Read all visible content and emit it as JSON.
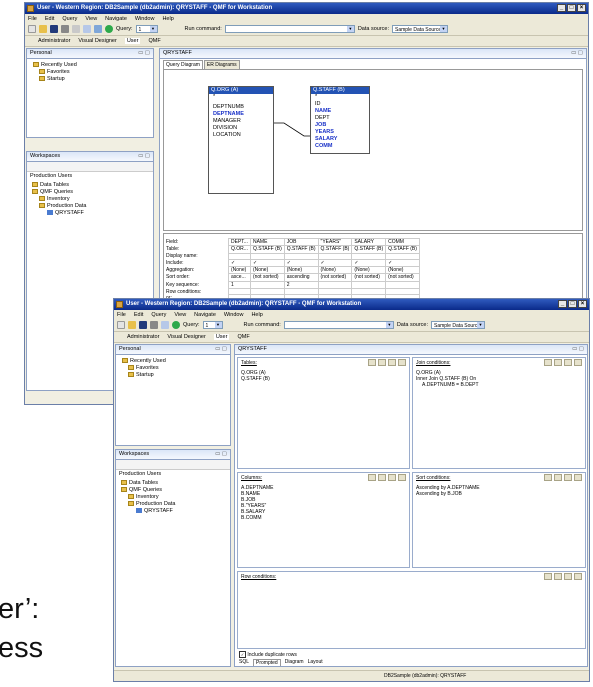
{
  "bg_text": {
    "line1": "er’:",
    "line2": "ess"
  },
  "back": {
    "title": "User - Western Region: DB2Sample (db2admin): QRYSTAFF - QMF for Workstation",
    "menu": [
      "File",
      "Edit",
      "Query",
      "View",
      "Navigate",
      "Window",
      "Help"
    ],
    "toolbar": {
      "query_label": "Query:",
      "query_value": "1",
      "run_label": "Run command:",
      "ds_label": "Data source:",
      "ds_value": "Sample Data Source"
    },
    "perspectives": [
      "Administrator",
      "Visual Designer",
      "User",
      "QMF"
    ],
    "personal": {
      "title": "Personal",
      "items": [
        "Recently Used",
        "Favorites",
        "Startup"
      ]
    },
    "workspaces": {
      "title": "Workspaces",
      "header": "Production Users",
      "items": [
        "Data Tables",
        "QMF Queries",
        "Inventory",
        "Production Data",
        "QRYSTAFF"
      ]
    },
    "editor_tab": "QRYSTAFF",
    "subtabs": [
      "Query Diagram",
      "ER Diagrams"
    ],
    "table_org": {
      "title": "Q.ORG (A)",
      "cols": [
        "*",
        "DEPTNUMB",
        "DEPTNAME",
        "MANAGER",
        "DIVISION",
        "LOCATION"
      ]
    },
    "table_staff": {
      "title": "Q.STAFF (B)",
      "cols": [
        "*",
        "ID",
        "NAME",
        "DEPT",
        "JOB",
        "YEARS",
        "SALARY",
        "COMM"
      ]
    },
    "grid": {
      "row_labels": [
        "Field:",
        "Table:",
        "Display name:",
        "Include:",
        "Aggregation:",
        "Sort order:",
        "Key sequence:",
        "Row conditions:",
        "or:"
      ],
      "columns": [
        [
          "DEPT...",
          "Q.OR...",
          "",
          "✓",
          "(None)",
          "asce...",
          "1",
          "",
          ""
        ],
        [
          "NAME",
          "Q.STAFF (B)",
          "",
          "✓",
          "(None)",
          "(not sorted)",
          "",
          "",
          ""
        ],
        [
          "JOB",
          "Q.STAFF (B)",
          "",
          "✓",
          "(None)",
          "ascending",
          "2",
          "",
          ""
        ],
        [
          "\"YEARS\"",
          "Q.STAFF (B)",
          "",
          "✓",
          "(None)",
          "(not sorted)",
          "",
          "",
          ""
        ],
        [
          "SALARY",
          "Q.STAFF (B)",
          "",
          "✓",
          "(None)",
          "(not sorted)",
          "",
          "",
          ""
        ],
        [
          "COMM",
          "Q.STAFF (B)",
          "",
          "✓",
          "(None)",
          "(not sorted)",
          "",
          "",
          ""
        ]
      ]
    }
  },
  "front": {
    "title": "User - Western Region: DB2Sample (db2admin): QRYSTAFF - QMF for Workstation",
    "menu": [
      "File",
      "Edit",
      "Query",
      "View",
      "Navigate",
      "Window",
      "Help"
    ],
    "toolbar": {
      "query_label": "Query:",
      "query_value": "1",
      "run_label": "Run command:",
      "ds_label": "Data source:",
      "ds_value": "Sample Data Source"
    },
    "perspectives": [
      "Administrator",
      "Visual Designer",
      "User",
      "QMF"
    ],
    "personal": {
      "title": "Personal",
      "items": [
        "Recently Used",
        "Favorites",
        "Startup"
      ]
    },
    "workspaces": {
      "title": "Workspaces",
      "header": "Production Users",
      "items": [
        "Data Tables",
        "QMF Queries",
        "Inventory",
        "Production Data",
        "QRYSTAFF"
      ]
    },
    "editor_tab": "QRYSTAFF",
    "tables": {
      "label": "Tables:",
      "lines": [
        "Q.ORG (A)",
        "Q.STAFF (B)"
      ]
    },
    "joins": {
      "label": "Join conditions:",
      "lines": [
        "Q.ORG (A)",
        "Inner Join Q.STAFF (B) On",
        "A.DEPTNUMB = B.DEPT"
      ]
    },
    "columns": {
      "label": "Columns:",
      "lines": [
        "A.DEPTNAME",
        "B.NAME",
        "B.JOB",
        "B.\"YEARS\"",
        "B.SALARY",
        "B.COMM"
      ]
    },
    "sorts": {
      "label": "Sort conditions:",
      "lines": [
        "Ascending by A.DEPTNAME",
        "Ascending by B.JOB"
      ]
    },
    "rowcond": {
      "label": "Row conditions:"
    },
    "include_dup": "Include duplicate rows",
    "bottom_tabs": [
      "SQL",
      "Prompted",
      "Diagram",
      "Layout"
    ],
    "status": "DB2Sample (db2admin): QRYSTAFF"
  }
}
